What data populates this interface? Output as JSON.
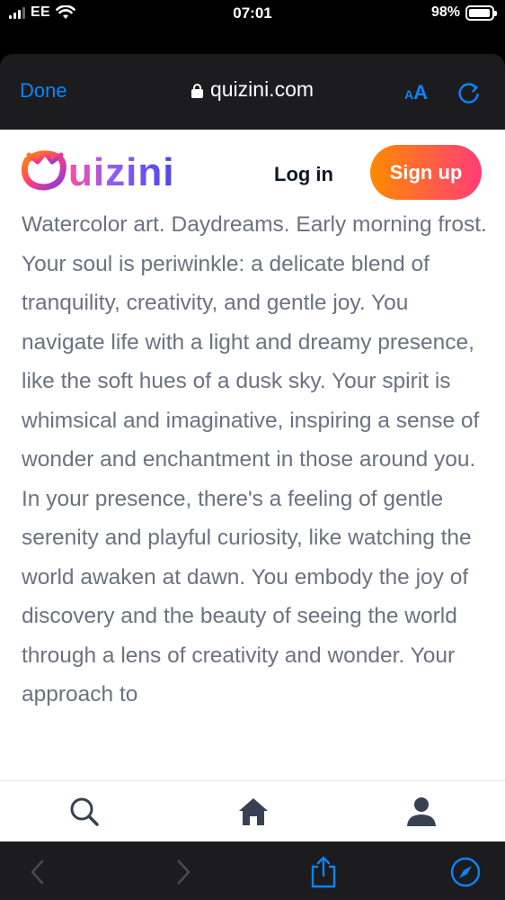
{
  "status_bar": {
    "carrier": "EE",
    "time": "07:01",
    "battery": "98%",
    "icons": [
      "signal-icon",
      "wifi-icon",
      "battery-icon"
    ]
  },
  "browser": {
    "done_label": "Done",
    "url": "quizini.com",
    "text_size_label": "AA",
    "icons": [
      "lock-icon",
      "reload-icon"
    ],
    "accent_color": "#0a84ff"
  },
  "header": {
    "logo_text": "Quizini",
    "login_label": "Log in",
    "signup_label": "Sign up"
  },
  "article": {
    "paragraphs": [
      "Watercolor art. Daydreams. Early morning frost.",
      "Your soul is periwinkle: a delicate blend of tranquility, creativity, and gentle joy. You navigate life with a light and dreamy presence, like the soft hues of a dusk sky. Your spirit is whimsical and imaginative, inspiring a sense of wonder and enchantment in those around you. In your presence, there's a feeling of gentle serenity and playful curiosity, like watching the world awaken at dawn. You embody the joy of discovery and the beauty of seeing the world through a lens of creativity and wonder. Your approach to"
    ]
  },
  "bottom_nav": {
    "icons": [
      "search-icon",
      "home-icon",
      "profile-icon"
    ]
  },
  "toolbar": {
    "icons": [
      "back-icon",
      "forward-icon",
      "share-icon",
      "compass-icon"
    ]
  }
}
